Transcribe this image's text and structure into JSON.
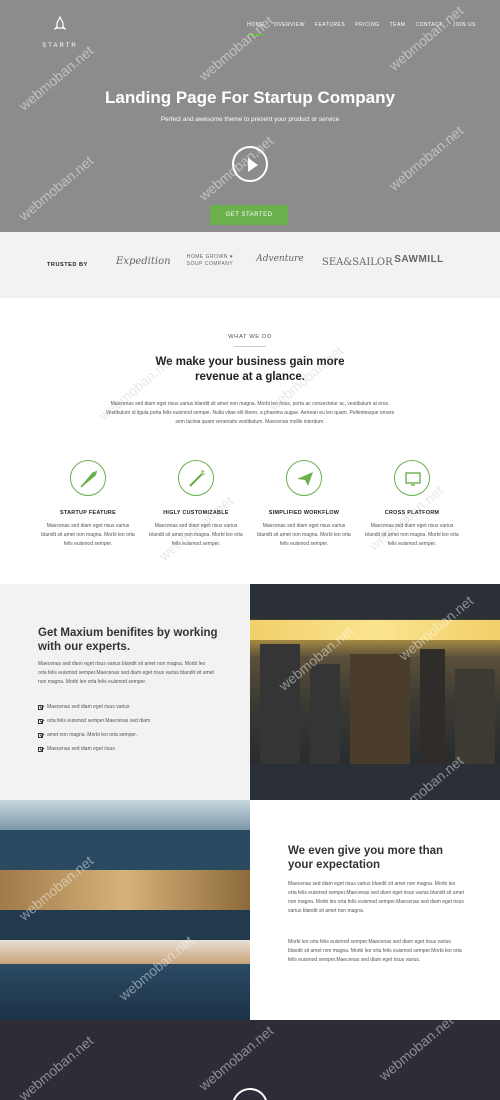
{
  "brand": {
    "name": "STARTR"
  },
  "nav": {
    "items": [
      "HOME",
      "OVERVIEW",
      "FEATURES",
      "PRICING",
      "TEAM",
      "CONTACT",
      "JOIN US"
    ],
    "active_index": 0
  },
  "hero": {
    "title": "Landing Page For Startup Company",
    "subtitle": "Perfect and awesome theme to present your product or service",
    "cta": "GET STARTED"
  },
  "trusted": {
    "label": "TRUSTED BY",
    "brands": [
      "Expedition",
      "HOME GROWN ♥ SOUP COMPANY",
      "Adventure",
      "SEA&SAILOR",
      "SAWMILL"
    ]
  },
  "what_we_do": {
    "tag": "WHAT WE DO",
    "headline": "We make your business gain more revenue at a glance.",
    "paragraph": "Maecenas sed diam eget risus varius blandit sit amet non magna. Morbi leo risus, porta ac consectetur ac, vestibulum at eros. Vestibulum id ligula porta felis euismod semper. Nulla vitae elit libero, a pharetra augue. Aenean eu leo quam. Pellentesque ornare sem lacinia quam venenatis vestibulum. Maecenas mollis interdum."
  },
  "features": [
    {
      "title": "STARTUP FEATURE",
      "text": "Maecenas sed diam eget risus varius blandit sit amet non magna. Morbi leo orta felis euismod semper.",
      "icon": "rocket-icon"
    },
    {
      "title": "HIGLY CUSTOMIZABLE",
      "text": "Maecenas sed diam eget risus varius blandit sit amet non magna. Morbi leo orta felis euismod semper.",
      "icon": "magic-wand-icon"
    },
    {
      "title": "SIMPLIFIED WORKFLOW",
      "text": "Maecenas sed diam eget risus varius blandit sit amet non magna. Morbi leo orta felis euismod semper.",
      "icon": "paper-plane-icon"
    },
    {
      "title": "CROSS PLATFORM",
      "text": "Maecenas sed diam eget risus varius blandit sit amet non magna. Morbi leo orta felis euismod semper.",
      "icon": "monitor-icon"
    }
  ],
  "benefits": {
    "title": "Get Maxium benifites by working with our experts.",
    "paragraph": "Maecenas sed diam eget risus varius blandit sit amet non magna. Morbi leo orta felis euismod semper.Maecenas sed diam eget risus varius blandit sit amet non magna. Morbi leo orta felis euismod semper.",
    "list": [
      "Maecenas sed diam eget risus varius",
      "orta felis euismod semper.Maecenas sed diam",
      "amet non magna. Morbi leo orta semper.",
      "Maecenas sed diam eget risus"
    ]
  },
  "expectation": {
    "title": "We even give you more than your expectation",
    "paragraph1": "Maecenas sed diam eget risus varius blandit sit amet non magna. Morbi leo orta felis euismod semper.Maecenas sed diam eget risus varius blandit sit amet non magna. Morbi leo orta felis euismod semper.Maecenas sed diam eget risus varius blandit sit amet non magna.",
    "paragraph2": "Morbi leo orta felis euismod semper.Maecenas sed diam eget risus varius blandit sit amet non magna. Morbi leo orta felis euismod semper.Morbi leo orta felis euismod semper.Maecenas sed diam eget risus varius."
  },
  "watermark": "webmoban.net",
  "colors": {
    "accent": "#6ab04c",
    "hero_bg": "#8d8b8e",
    "dark_bg": "#2e2c36"
  }
}
